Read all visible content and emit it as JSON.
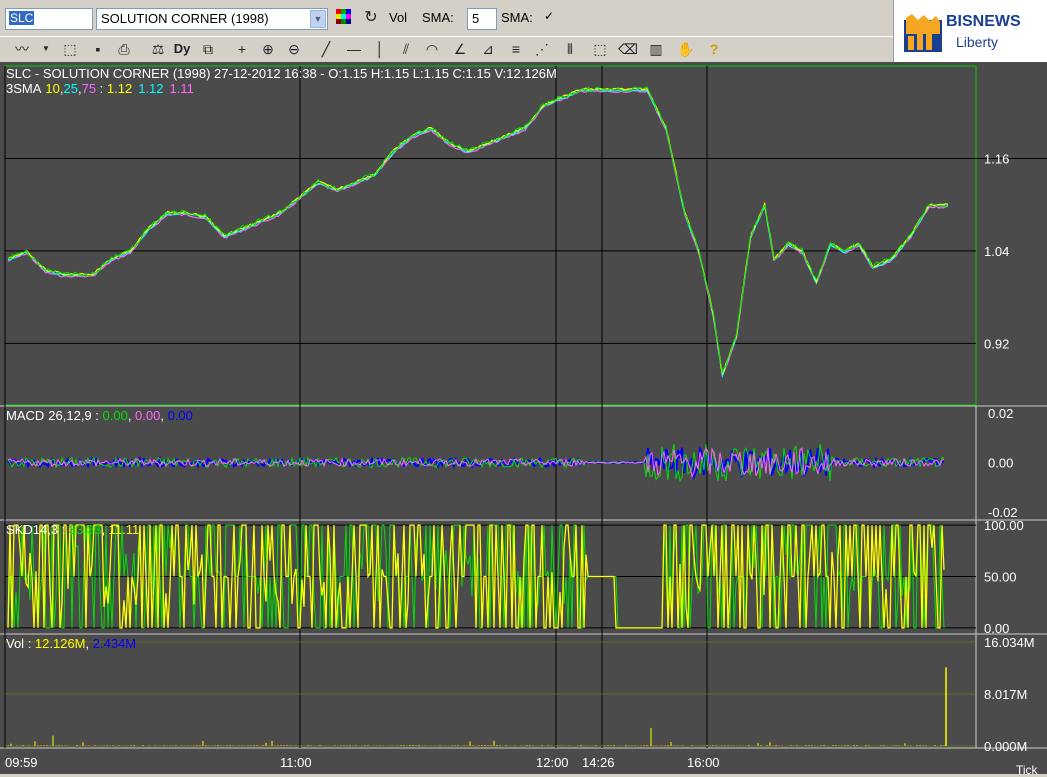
{
  "toolbar": {
    "symbol": "SLC",
    "stock_name": "SOLUTION CORNER (1998)",
    "vol_label": "Vol",
    "sma_label": "SMA:",
    "sma_value": "5",
    "sma2_label": "SMA:",
    "sma2_checked": "✓",
    "icons": [
      "color-palette-icon",
      "refresh-icon",
      "line-chart-icon",
      "dropdown-icon",
      "export-icon",
      "save-icon",
      "print-icon",
      "indicator-icon",
      "dy-icon",
      "resize-icon",
      "crosshair-icon",
      "zoom-in-icon",
      "zoom-out-icon",
      "trendline-icon",
      "hline-icon",
      "vline-icon",
      "channel-icon",
      "arc-icon",
      "fan-icon",
      "fan2-icon",
      "fibonacci-icon",
      "gann-icon",
      "cycle-icon",
      "select-icon",
      "delete-icon",
      "delete-all-icon",
      "hand-icon",
      "help-icon"
    ],
    "dy_label": "Dy"
  },
  "logo": {
    "brand": "BISNEWS",
    "sub": "Liberty"
  },
  "colors": {
    "background": "#4b4b4b",
    "grid": "#000000",
    "green": "#00e000",
    "yellow": "#ffff00",
    "cyan": "#00ffff",
    "magenta": "#ff66ff",
    "blue": "#0000ff"
  },
  "header": {
    "title": "SLC - SOLUTION CORNER (1998) 27-12-2012 16:38 - O:1.15 H:1.15 L:1.15 C:1.15 V:12.126M",
    "sma_label": "3SMA",
    "sma_periods": [
      "10",
      ",",
      "25",
      ",",
      "75"
    ],
    "sma_sep": " : ",
    "sma_values": [
      "1.12",
      "1.12",
      "1.11"
    ]
  },
  "chart_data": [
    {
      "type": "line",
      "panel": "price",
      "y_ticks": [
        "1.16",
        "1.04",
        "0.92"
      ],
      "ylim": [
        0.84,
        1.28
      ],
      "series": [
        {
          "name": "10",
          "color": "#ffff00"
        },
        {
          "name": "25",
          "color": "#00ffff"
        },
        {
          "name": "75",
          "color": "#ff66ff"
        }
      ],
      "close_path": [
        [
          0.0,
          1.03
        ],
        [
          0.02,
          1.04
        ],
        [
          0.04,
          1.015
        ],
        [
          0.06,
          1.01
        ],
        [
          0.09,
          1.01
        ],
        [
          0.11,
          1.03
        ],
        [
          0.13,
          1.04
        ],
        [
          0.15,
          1.07
        ],
        [
          0.17,
          1.09
        ],
        [
          0.19,
          1.09
        ],
        [
          0.21,
          1.085
        ],
        [
          0.23,
          1.06
        ],
        [
          0.25,
          1.07
        ],
        [
          0.27,
          1.08
        ],
        [
          0.29,
          1.09
        ],
        [
          0.31,
          1.11
        ],
        [
          0.33,
          1.13
        ],
        [
          0.35,
          1.12
        ],
        [
          0.37,
          1.13
        ],
        [
          0.39,
          1.14
        ],
        [
          0.41,
          1.17
        ],
        [
          0.43,
          1.19
        ],
        [
          0.45,
          1.2
        ],
        [
          0.47,
          1.18
        ],
        [
          0.49,
          1.17
        ],
        [
          0.51,
          1.18
        ],
        [
          0.53,
          1.19
        ],
        [
          0.55,
          1.2
        ],
        [
          0.57,
          1.23
        ],
        [
          0.59,
          1.24
        ],
        [
          0.61,
          1.25
        ],
        [
          0.63,
          1.25
        ],
        [
          0.66,
          1.25
        ],
        [
          0.68,
          1.25
        ],
        [
          0.7,
          1.2
        ],
        [
          0.72,
          1.09
        ],
        [
          0.735,
          1.04
        ],
        [
          0.75,
          0.96
        ],
        [
          0.76,
          0.88
        ],
        [
          0.775,
          0.93
        ],
        [
          0.79,
          1.06
        ],
        [
          0.805,
          1.1
        ],
        [
          0.815,
          1.03
        ],
        [
          0.83,
          1.05
        ],
        [
          0.845,
          1.04
        ],
        [
          0.86,
          1.0
        ],
        [
          0.875,
          1.05
        ],
        [
          0.89,
          1.04
        ],
        [
          0.905,
          1.05
        ],
        [
          0.92,
          1.02
        ],
        [
          0.94,
          1.03
        ],
        [
          0.96,
          1.06
        ],
        [
          0.98,
          1.1
        ],
        [
          1.0,
          1.1
        ]
      ]
    },
    {
      "type": "line",
      "panel": "macd",
      "title": "MACD",
      "params": "26,12,9",
      "values": [
        "0.00",
        "0.00",
        "0.00"
      ],
      "y_ticks": [
        "0.02",
        "0.00",
        "-0.02"
      ],
      "ylim": [
        -0.022,
        0.022
      ]
    },
    {
      "type": "line",
      "panel": "stochastic",
      "title": "SKD",
      "params": "14,3",
      "values": [
        "33.33",
        "11.11"
      ],
      "y_ticks": [
        "100.00",
        "50.00",
        "0.00"
      ],
      "ylim": [
        -5,
        105
      ]
    },
    {
      "type": "bar",
      "panel": "volume",
      "title": "Vol",
      "values": [
        "12.126M",
        "2.434M"
      ],
      "y_ticks": [
        "16.034M",
        "8.017M",
        "0.000M"
      ],
      "ylim": [
        0,
        16.034
      ]
    }
  ],
  "x_axis": {
    "ticks": [
      "09:59",
      "11:00",
      "12:00",
      "14:26",
      "16:00"
    ],
    "unit_label": "Tick"
  }
}
